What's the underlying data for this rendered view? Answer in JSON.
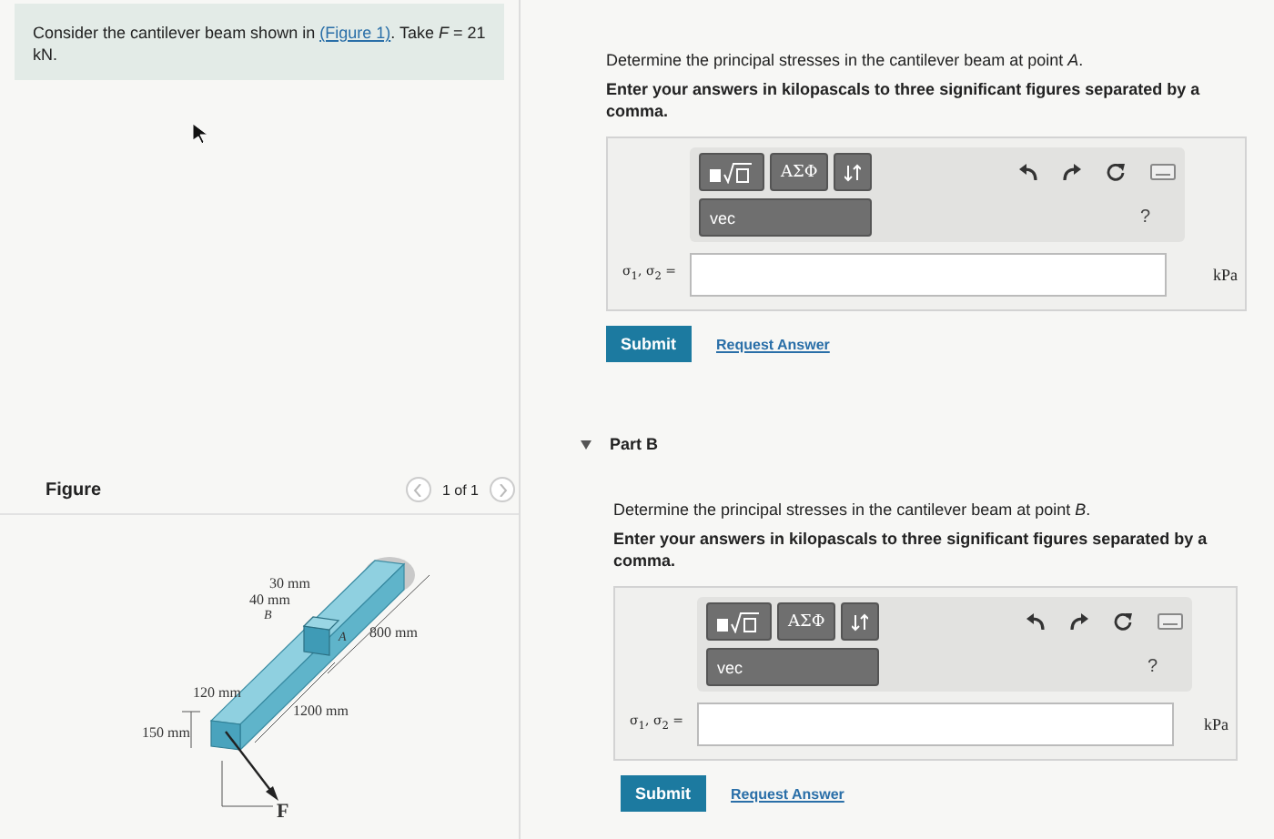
{
  "problem": {
    "lead": "Consider the cantilever beam shown in ",
    "link": "(Figure 1)",
    "tail": ". Take *F* = 21 kN."
  },
  "figure": {
    "title": "Figure",
    "pager": "1 of 1",
    "labels": [
      {
        "text": "30 mm"
      },
      {
        "text": "40 mm"
      },
      {
        "text": "B"
      },
      {
        "text": "A"
      },
      {
        "text": "800 mm"
      },
      {
        "text": "120 mm"
      },
      {
        "text": "1200 mm"
      },
      {
        "text": "150 mm"
      },
      {
        "text": "F"
      }
    ]
  },
  "parts": [
    {
      "question": "Determine the principal stresses in the cantilever beam at point *A*.",
      "instruction": "Enter your answers in kilopascals to three significant figures separated by a comma.",
      "toolbar": {
        "symbols": "ΑΣΦ",
        "vec": "vec",
        "help": "?"
      },
      "variable": "σ$_{1}$, σ$_{2}$ =",
      "unit": "kPa",
      "submit": "Submit",
      "request": "Request Answer"
    },
    {
      "header": "Part B",
      "expanded": true,
      "question": "Determine the principal stresses in the cantilever beam at point *B*.",
      "instruction": "Enter your answers in kilopascals to three significant figures separated by a comma.",
      "toolbar": {
        "symbols": "ΑΣΦ",
        "vec": "vec",
        "help": "?"
      },
      "variable": "σ$_{1}$, σ$_{2}$ =",
      "unit": "kPa",
      "submit": "Submit",
      "request": "Request Answer"
    }
  ]
}
